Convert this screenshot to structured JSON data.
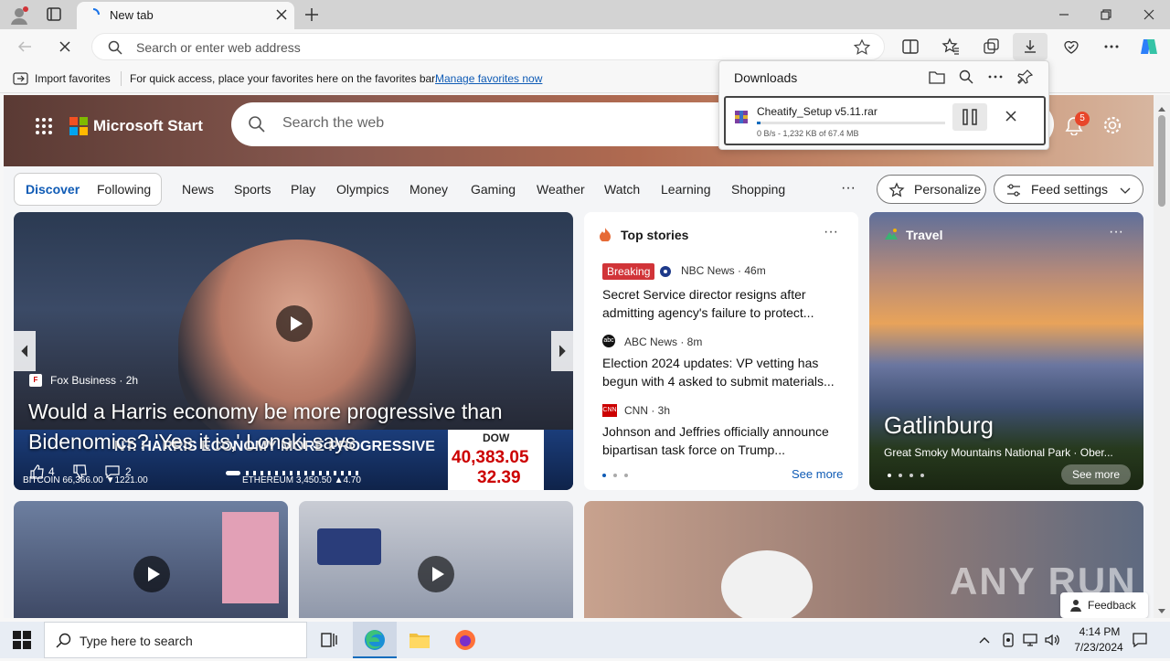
{
  "browser": {
    "tab_title": "New tab",
    "address_placeholder": "Search or enter web address",
    "favorites_bar": {
      "import_label": "Import favorites",
      "hint_text": "For quick access, place your favorites here on the favorites bar.",
      "manage_link": "Manage favorites now"
    }
  },
  "downloads": {
    "title": "Downloads",
    "item": {
      "filename": "Cheatify_Setup v5.11.rar",
      "status": "0 B/s - 1,232 KB of 67.4 MB",
      "progress": 0.018
    }
  },
  "msn": {
    "brand": "Microsoft Start",
    "search_placeholder": "Search the web",
    "notification_count": "5",
    "nav": {
      "discover": "Discover",
      "following": "Following",
      "tabs": [
        "News",
        "Sports",
        "Play",
        "Olympics",
        "Money",
        "Gaming",
        "Weather",
        "Watch",
        "Learning",
        "Shopping"
      ],
      "more": "···",
      "personalize": "Personalize",
      "feed_settings": "Feed settings"
    },
    "hero_story": {
      "source": "Fox Business · 2h",
      "headline": "Would a Harris economy be more progressive than Bidenomics? 'Yes it is,' Lonski says",
      "likes": "4",
      "comments": "2",
      "ticker_dow_label": "DOW",
      "ticker_dow_value": "40,383.05",
      "ticker_dow_change": "32.39",
      "ticker_bitcoin": "BITCOIN 66,366.00 ▼1221.00",
      "ticker_ethereum": "ETHEREUM 3,450.50 ▲4.70",
      "banner_text": "NT: HARRIS ECONOMY MORE PROGRESSIVE"
    },
    "top_stories": {
      "title": "Top stories",
      "see_more": "See more",
      "items": [
        {
          "badge": "Breaking",
          "source": "NBC News · 46m",
          "headline": "Secret Service director resigns after admitting agency's failure to protect..."
        },
        {
          "badge": "",
          "source": "ABC News · 8m",
          "headline": "Election 2024 updates: VP vetting has begun with 4 asked to submit materials..."
        },
        {
          "badge": "",
          "source": "CNN · 3h",
          "headline": "Johnson and Jeffries officially announce bipartisan task force on Trump..."
        }
      ]
    },
    "travel": {
      "title": "Travel",
      "place": "Gatlinburg",
      "subtitle": "Great Smoky Mountains National Park · Ober...",
      "see_more": "See more"
    },
    "feedback": "Feedback",
    "watermark": "ANY RUN"
  },
  "taskbar": {
    "search_placeholder": "Type here to search",
    "time": "4:14 PM",
    "date": "7/23/2024"
  }
}
